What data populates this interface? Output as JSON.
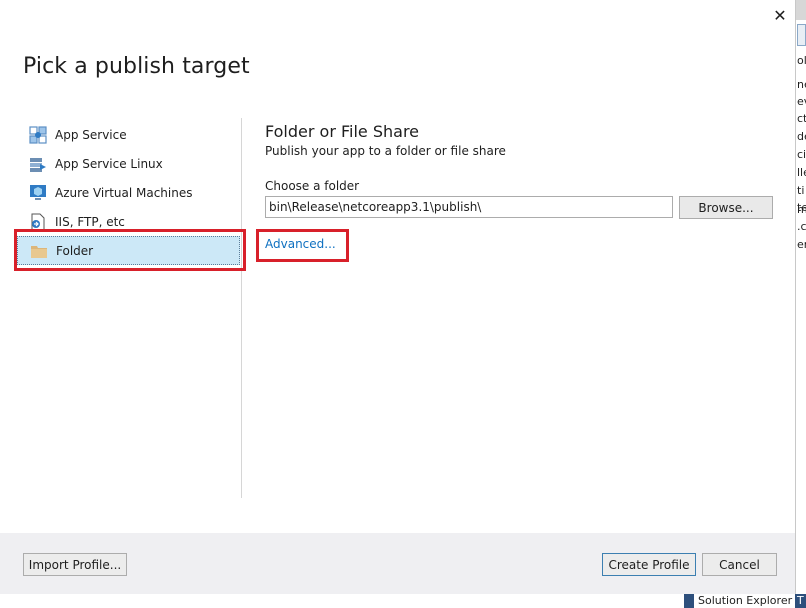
{
  "dialog": {
    "title": "Pick a publish target",
    "close_glyph": "✕"
  },
  "nav": {
    "items": [
      {
        "label": "App Service",
        "icon": "app-service-icon"
      },
      {
        "label": "App Service Linux",
        "icon": "app-service-linux-icon"
      },
      {
        "label": "Azure Virtual Machines",
        "icon": "virtual-machine-icon"
      },
      {
        "label": "IIS, FTP, etc",
        "icon": "iis-ftp-icon"
      },
      {
        "label": "Folder",
        "icon": "folder-icon",
        "selected": true
      }
    ]
  },
  "panel": {
    "title": "Folder or File Share",
    "subtitle": "Publish your app to a folder or file share",
    "choose_label": "Choose a folder",
    "folder_value": "bin\\Release\\netcoreapp3.1\\publish\\",
    "browse_label": "Browse...",
    "advanced_label": "Advanced..."
  },
  "footer": {
    "import_label": "Import Profile...",
    "create_label": "Create Profile",
    "cancel_label": "Cancel"
  },
  "background": {
    "strip_lines": [
      "ol",
      "ne",
      "ev",
      "ct",
      "de",
      "ci",
      "lle",
      "ti",
      "te",
      "m",
      ".c",
      "er"
    ],
    "solution_explorer": "Solution Explorer",
    "tab_letter": "T"
  },
  "colors": {
    "highlight": "#d8202a",
    "selection": "#cce8f7",
    "link": "#0e70c0"
  }
}
